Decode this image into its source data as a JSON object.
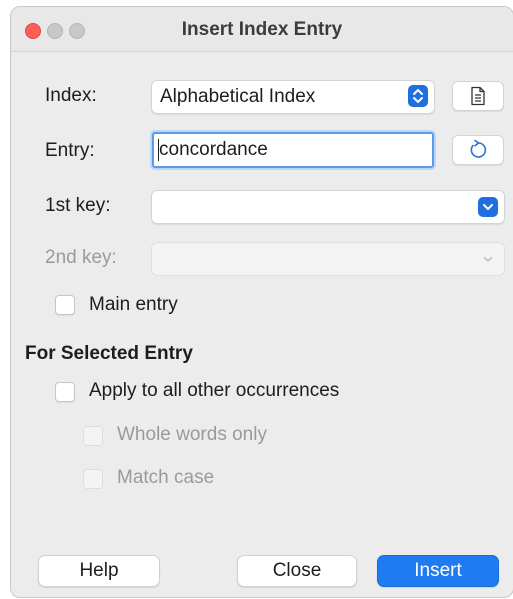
{
  "window": {
    "title": "Insert Index Entry"
  },
  "colors": {
    "accent": "#1f7bf2",
    "close_dot": "#ff5f57",
    "focus_ring": "#5b9bea"
  },
  "form": {
    "index": {
      "label": "Index:",
      "value": "Alphabetical Index",
      "new_button_icon": "document-icon"
    },
    "entry": {
      "label": "Entry:",
      "value": "concordance",
      "refresh_button_icon": "refresh-icon"
    },
    "key1": {
      "label": "1st key:",
      "value": ""
    },
    "key2": {
      "label": "2nd key:",
      "value": ""
    },
    "main_entry": {
      "label": "Main entry",
      "checked": false
    }
  },
  "selected_entry": {
    "heading": "For Selected Entry",
    "apply_all": {
      "label": "Apply to all other occurrences",
      "checked": false
    },
    "whole_words": {
      "label": "Whole words only",
      "checked": false
    },
    "match_case": {
      "label": "Match case",
      "checked": false
    }
  },
  "buttons": {
    "help": "Help",
    "close": "Close",
    "insert": "Insert"
  }
}
